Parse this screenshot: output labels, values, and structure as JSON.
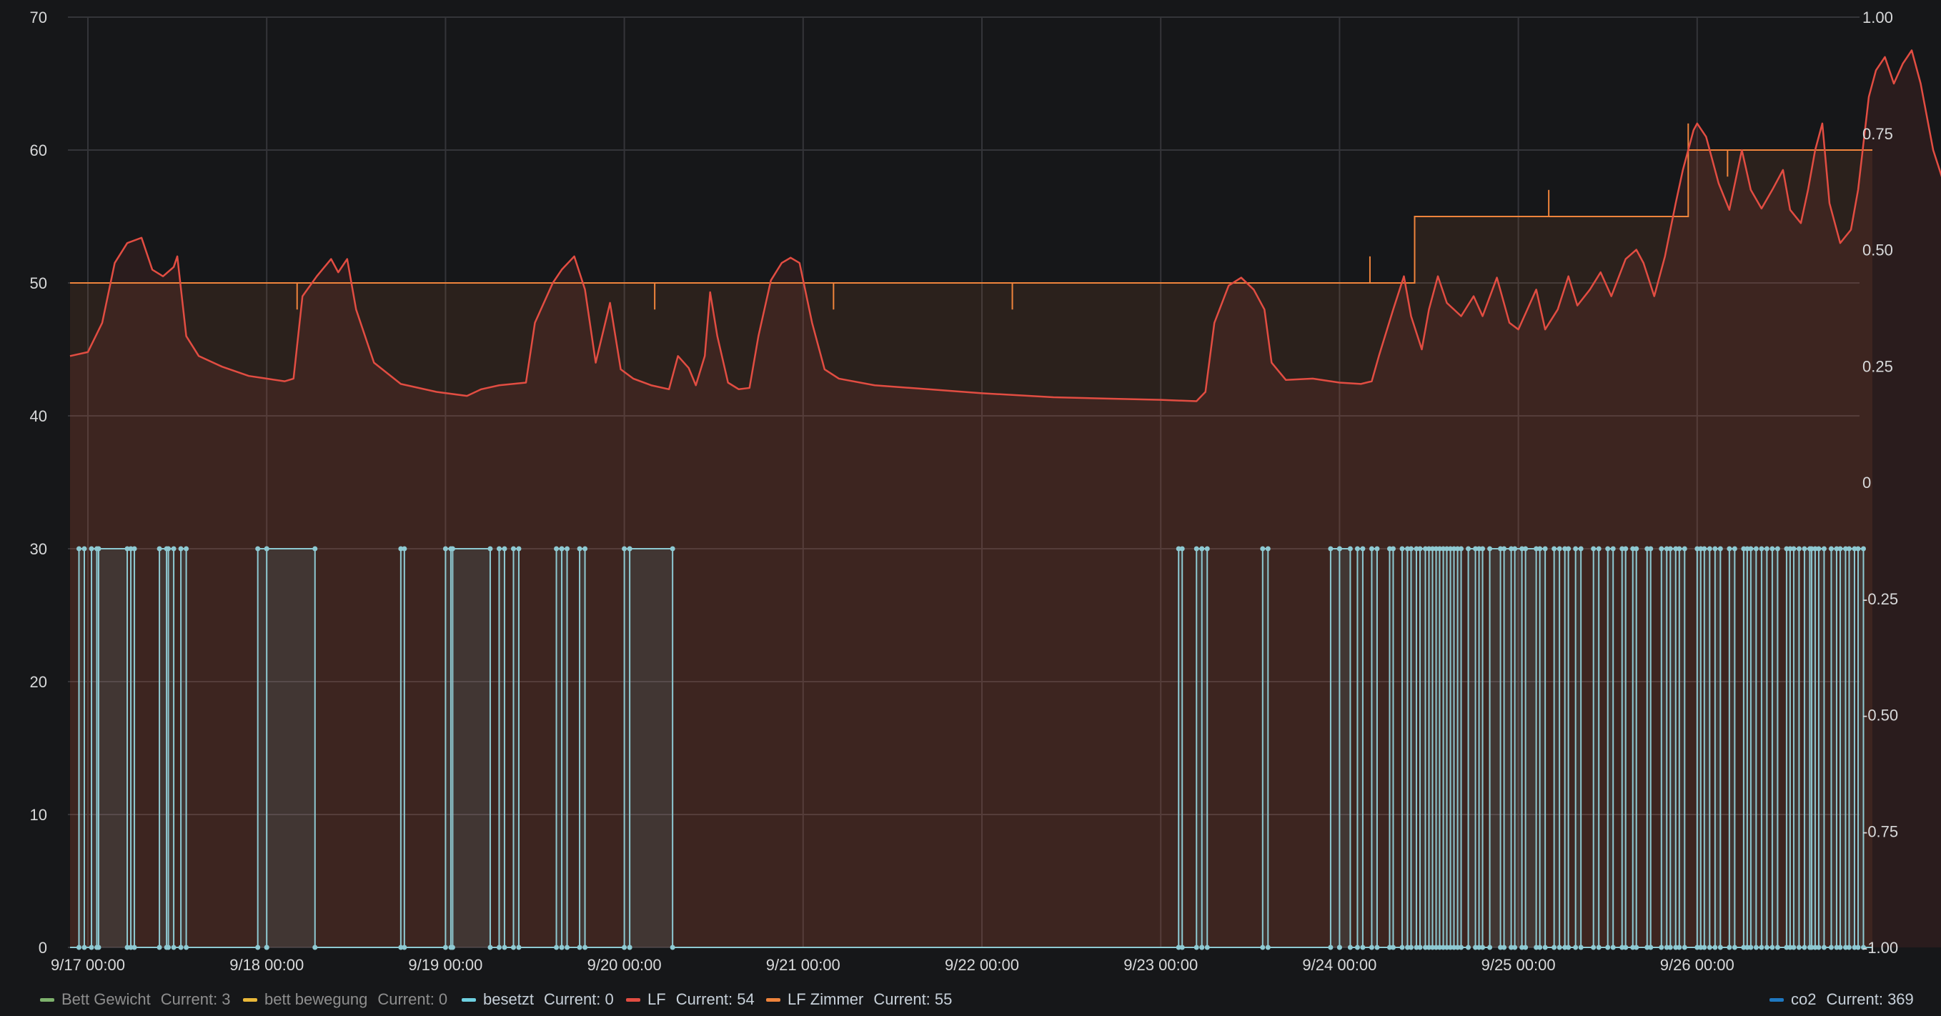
{
  "chart_data": {
    "type": "line",
    "x_ticks": [
      "9/17 00:00",
      "9/18 00:00",
      "9/19 00:00",
      "9/20 00:00",
      "9/21 00:00",
      "9/22 00:00",
      "9/23 00:00",
      "9/24 00:00",
      "9/25 00:00",
      "9/26 00:00"
    ],
    "y_left": {
      "ticks": [
        "0",
        "10",
        "20",
        "30",
        "40",
        "50",
        "60",
        "70"
      ],
      "range": [
        0,
        70
      ]
    },
    "y_right": {
      "ticks": [
        "-1.00",
        "-0.75",
        "-0.50",
        "-0.25",
        "0",
        "0.25",
        "0.50",
        "0.75",
        "1.00"
      ],
      "range": [
        -1,
        1
      ]
    },
    "x_range_days": [
      -0.1,
      9.98
    ],
    "grid": true,
    "legend_position": "bottom",
    "series": [
      {
        "name": "LF",
        "color": "#e24d42",
        "current": "Current: 54",
        "values": [
          [
            -0.1,
            44.5
          ],
          [
            0,
            44.8
          ],
          [
            0.08,
            47
          ],
          [
            0.15,
            51.5
          ],
          [
            0.22,
            53
          ],
          [
            0.3,
            53.4
          ],
          [
            0.36,
            51
          ],
          [
            0.42,
            50.5
          ],
          [
            0.48,
            51.2
          ],
          [
            0.5,
            52
          ],
          [
            0.55,
            46
          ],
          [
            0.62,
            44.5
          ],
          [
            0.75,
            43.7
          ],
          [
            0.9,
            43
          ],
          [
            1.0,
            42.8
          ],
          [
            1.1,
            42.6
          ],
          [
            1.15,
            42.8
          ],
          [
            1.2,
            49
          ],
          [
            1.28,
            50.5
          ],
          [
            1.36,
            51.8
          ],
          [
            1.4,
            50.8
          ],
          [
            1.45,
            51.8
          ],
          [
            1.5,
            48
          ],
          [
            1.6,
            44
          ],
          [
            1.75,
            42.4
          ],
          [
            1.95,
            41.8
          ],
          [
            2.12,
            41.5
          ],
          [
            2.2,
            42
          ],
          [
            2.3,
            42.3
          ],
          [
            2.45,
            42.5
          ],
          [
            2.5,
            47
          ],
          [
            2.6,
            50
          ],
          [
            2.65,
            51
          ],
          [
            2.72,
            52
          ],
          [
            2.78,
            49.5
          ],
          [
            2.84,
            44
          ],
          [
            2.92,
            48.5
          ],
          [
            2.98,
            43.5
          ],
          [
            3.05,
            42.8
          ],
          [
            3.15,
            42.3
          ],
          [
            3.25,
            42
          ],
          [
            3.3,
            44.5
          ],
          [
            3.36,
            43.6
          ],
          [
            3.4,
            42.3
          ],
          [
            3.45,
            44.5
          ],
          [
            3.48,
            49.3
          ],
          [
            3.52,
            46
          ],
          [
            3.58,
            42.5
          ],
          [
            3.64,
            42
          ],
          [
            3.7,
            42.1
          ],
          [
            3.75,
            46
          ],
          [
            3.82,
            50.2
          ],
          [
            3.88,
            51.5
          ],
          [
            3.93,
            51.9
          ],
          [
            3.98,
            51.5
          ],
          [
            4.05,
            47
          ],
          [
            4.12,
            43.5
          ],
          [
            4.2,
            42.8
          ],
          [
            4.4,
            42.3
          ],
          [
            4.7,
            42
          ],
          [
            5.0,
            41.7
          ],
          [
            5.4,
            41.4
          ],
          [
            5.7,
            41.3
          ],
          [
            6.0,
            41.2
          ],
          [
            6.2,
            41.1
          ],
          [
            6.25,
            41.8
          ],
          [
            6.3,
            47
          ],
          [
            6.38,
            49.8
          ],
          [
            6.45,
            50.4
          ],
          [
            6.52,
            49.5
          ],
          [
            6.58,
            48
          ],
          [
            6.62,
            44
          ],
          [
            6.7,
            42.7
          ],
          [
            6.85,
            42.8
          ],
          [
            7.0,
            42.5
          ],
          [
            7.12,
            42.4
          ],
          [
            7.18,
            42.6
          ],
          [
            7.22,
            44.5
          ],
          [
            7.3,
            48
          ],
          [
            7.36,
            50.5
          ],
          [
            7.4,
            47.5
          ],
          [
            7.46,
            45
          ],
          [
            7.5,
            48
          ],
          [
            7.55,
            50.5
          ],
          [
            7.6,
            48.5
          ],
          [
            7.68,
            47.5
          ],
          [
            7.75,
            49
          ],
          [
            7.8,
            47.5
          ],
          [
            7.88,
            50.4
          ],
          [
            7.95,
            47
          ],
          [
            8.0,
            46.5
          ],
          [
            8.05,
            48
          ],
          [
            8.1,
            49.5
          ],
          [
            8.15,
            46.5
          ],
          [
            8.22,
            48
          ],
          [
            8.28,
            50.5
          ],
          [
            8.33,
            48.3
          ],
          [
            8.4,
            49.5
          ],
          [
            8.46,
            50.8
          ],
          [
            8.52,
            49
          ],
          [
            8.6,
            51.8
          ],
          [
            8.66,
            52.5
          ],
          [
            8.7,
            51.5
          ],
          [
            8.76,
            49
          ],
          [
            8.82,
            52
          ],
          [
            8.88,
            56
          ],
          [
            8.92,
            58.5
          ],
          [
            8.98,
            61.5
          ],
          [
            9.0,
            62
          ],
          [
            9.05,
            61
          ],
          [
            9.12,
            57.5
          ],
          [
            9.18,
            55.5
          ],
          [
            9.25,
            60
          ],
          [
            9.3,
            57
          ],
          [
            9.36,
            55.6
          ],
          [
            9.42,
            57
          ],
          [
            9.48,
            58.5
          ],
          [
            9.52,
            55.5
          ],
          [
            9.58,
            54.5
          ],
          [
            9.62,
            57
          ],
          [
            9.66,
            60
          ],
          [
            9.7,
            62
          ],
          [
            9.74,
            56
          ],
          [
            9.8,
            53
          ],
          [
            9.86,
            54
          ],
          [
            9.9,
            57
          ],
          [
            9.96,
            64
          ],
          [
            10.0,
            66
          ],
          [
            10.05,
            67
          ],
          [
            10.1,
            65
          ],
          [
            10.15,
            66.5
          ],
          [
            10.2,
            67.5
          ],
          [
            10.25,
            65
          ],
          [
            10.32,
            60
          ],
          [
            10.38,
            57.5
          ],
          [
            10.45,
            61
          ],
          [
            10.5,
            63
          ],
          [
            10.56,
            59
          ],
          [
            10.62,
            60
          ],
          [
            10.66,
            62.5
          ],
          [
            10.72,
            59
          ],
          [
            10.8,
            57.8
          ],
          [
            10.86,
            59.5
          ],
          [
            10.92,
            61
          ],
          [
            10.98,
            57.5
          ],
          [
            11.05,
            55.5
          ],
          [
            11.12,
            55
          ],
          [
            11.18,
            54
          ],
          [
            11.24,
            58
          ],
          [
            11.32,
            56
          ],
          [
            11.4,
            54
          ],
          [
            11.48,
            54.3
          ],
          [
            11.56,
            55
          ],
          [
            11.62,
            56.5
          ],
          [
            11.7,
            55
          ],
          [
            11.78,
            55.2
          ],
          [
            11.85,
            54.2
          ],
          [
            11.92,
            56.8
          ]
        ]
      },
      {
        "name": "LF Zimmer",
        "color": "#ef843c",
        "current": "Current: 55",
        "values": [
          [
            -0.1,
            50
          ],
          [
            0.23,
            50
          ],
          [
            7.42,
            50
          ],
          [
            7.42,
            55
          ],
          [
            8.18,
            55
          ],
          [
            8.18,
            55
          ],
          [
            8.95,
            55
          ],
          [
            8.95,
            60
          ],
          [
            9.6,
            60
          ],
          [
            9.6,
            60
          ],
          [
            9.78,
            60
          ],
          [
            9.78,
            60
          ],
          [
            9.98,
            60
          ]
        ],
        "spikes_down_at": [
          1.17,
          3.17,
          4.17,
          5.17,
          9.17
        ],
        "spikes_up_at": [
          7.17,
          8.17,
          8.95
        ]
      },
      {
        "name": "besetzt",
        "color": "#6ed0e0",
        "current": "Current: 0",
        "state_high": 30,
        "state_low": 0,
        "on_intervals": [
          [
            -0.05,
            -0.02
          ],
          [
            0.02,
            0.06
          ],
          [
            0.05,
            0.22
          ],
          [
            0.24,
            0.26
          ],
          [
            0.4,
            0.44
          ],
          [
            0.45,
            0.48
          ],
          [
            0.52,
            0.55
          ],
          [
            0.95,
            1.0
          ],
          [
            1.0,
            1.27
          ],
          [
            1.75,
            1.77
          ],
          [
            2.0,
            2.03
          ],
          [
            2.04,
            2.25
          ],
          [
            2.3,
            2.33
          ],
          [
            2.38,
            2.41
          ],
          [
            2.62,
            2.65
          ],
          [
            2.65,
            2.68
          ],
          [
            2.75,
            2.78
          ],
          [
            3.0,
            3.03
          ],
          [
            3.03,
            3.27
          ],
          [
            6.1,
            6.12
          ],
          [
            6.2,
            6.23
          ],
          [
            6.23,
            6.26
          ],
          [
            6.57,
            6.6
          ],
          [
            6.95,
            7.0
          ],
          [
            7.0,
            7.06
          ],
          [
            7.1,
            7.13
          ],
          [
            7.18,
            7.21
          ],
          [
            7.28,
            7.3
          ],
          [
            7.35,
            7.38
          ],
          [
            7.4,
            7.43
          ],
          [
            7.45,
            7.48
          ],
          [
            7.5,
            7.52
          ],
          [
            7.54,
            7.56
          ],
          [
            7.58,
            7.6
          ],
          [
            7.62,
            7.64
          ],
          [
            7.66,
            7.68
          ],
          [
            7.72,
            7.76
          ],
          [
            7.78,
            7.8
          ],
          [
            7.84,
            7.9
          ],
          [
            7.92,
            7.96
          ],
          [
            7.98,
            8.02
          ],
          [
            8.04,
            8.1
          ],
          [
            8.12,
            8.15
          ],
          [
            8.2,
            8.23
          ],
          [
            8.26,
            8.28
          ],
          [
            8.32,
            8.35
          ],
          [
            8.42,
            8.45
          ],
          [
            8.5,
            8.53
          ],
          [
            8.58,
            8.6
          ],
          [
            8.64,
            8.66
          ],
          [
            8.72,
            8.74
          ],
          [
            8.8,
            8.83
          ],
          [
            8.85,
            8.88
          ],
          [
            8.9,
            8.93
          ],
          [
            9.0,
            9.02
          ],
          [
            9.04,
            9.07
          ],
          [
            9.1,
            9.13
          ],
          [
            9.18,
            9.21
          ],
          [
            9.26,
            9.28
          ],
          [
            9.3,
            9.33
          ],
          [
            9.36,
            9.39
          ],
          [
            9.42,
            9.45
          ],
          [
            9.5,
            9.52
          ],
          [
            9.54,
            9.57
          ],
          [
            9.6,
            9.63
          ],
          [
            9.64,
            9.66
          ],
          [
            9.68,
            9.71
          ],
          [
            9.75,
            9.78
          ],
          [
            9.8,
            9.83
          ],
          [
            9.85,
            9.88
          ],
          [
            9.9,
            9.93
          ]
        ]
      },
      {
        "name": "Bett Gewicht",
        "color": "#7eb26d",
        "current": "Current: 3"
      },
      {
        "name": "bett bewegung",
        "color": "#eab839",
        "current": "Current: 0"
      },
      {
        "name": "co2",
        "color": "#1f78c1",
        "current": "Current: 369"
      }
    ]
  },
  "legend": [
    {
      "name": "Bett Gewicht",
      "current": "Current: 3",
      "color": "#7eb26d"
    },
    {
      "name": "bett bewegung",
      "current": "Current: 0",
      "color": "#eab839"
    },
    {
      "name": "besetzt",
      "current": "Current: 0",
      "color": "#6ed0e0"
    },
    {
      "name": "LF",
      "current": "Current: 54",
      "color": "#e24d42"
    },
    {
      "name": "LF Zimmer",
      "current": "Current: 55",
      "color": "#ef843c"
    },
    {
      "name": "co2",
      "current": "Current: 369",
      "color": "#1f78c1"
    }
  ]
}
